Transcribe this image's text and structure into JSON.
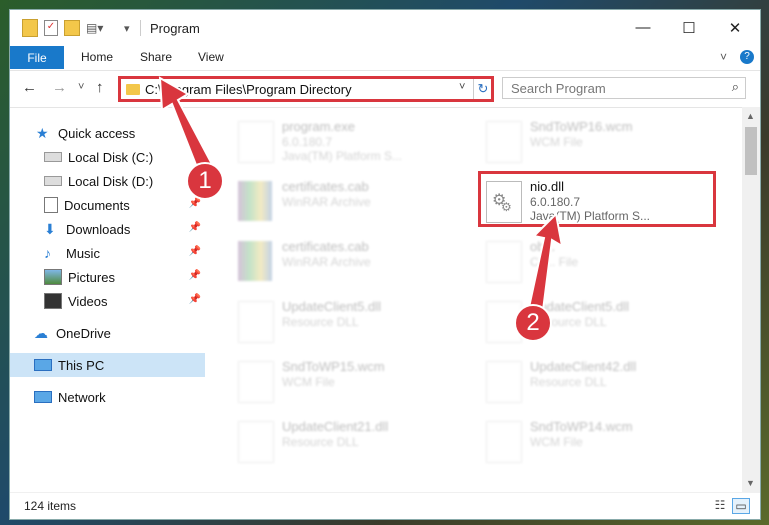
{
  "titlebar": {
    "title": "Program",
    "minimize_glyph": "—",
    "maximize_glyph": "☐",
    "close_glyph": "✕"
  },
  "ribbon": {
    "file": "File",
    "tabs": [
      "Home",
      "Share",
      "View"
    ],
    "expand_glyph": "˅",
    "help_glyph": "?"
  },
  "nav": {
    "back_glyph": "←",
    "forward_glyph": "→",
    "recent_glyph": "˅",
    "up_glyph": "↑",
    "address": "C:\\Program Files\\Program Directory",
    "address_drop": "˅",
    "refresh_glyph": "↻",
    "search_placeholder": "Search Program",
    "search_glyph": "⌕"
  },
  "sidebar": {
    "items": [
      {
        "label": "Quick access",
        "icon": "star-icon"
      },
      {
        "label": "Local Disk (C:)",
        "icon": "drive-icon"
      },
      {
        "label": "Local Disk (D:)",
        "icon": "drive-icon"
      },
      {
        "label": "Documents",
        "icon": "documents-icon"
      },
      {
        "label": "Downloads",
        "icon": "download-icon"
      },
      {
        "label": "Music",
        "icon": "music-icon"
      },
      {
        "label": "Pictures",
        "icon": "pictures-icon"
      },
      {
        "label": "Videos",
        "icon": "videos-icon"
      },
      {
        "label": "OneDrive",
        "icon": "cloud-icon"
      },
      {
        "label": "This PC",
        "icon": "computer-icon"
      },
      {
        "label": "Network",
        "icon": "network-icon"
      }
    ],
    "pin_glyph": "📌"
  },
  "files": [
    {
      "name": "program.exe",
      "line2": "6.0.180.7",
      "line3": "Java(TM) Platform S...",
      "type": "exe"
    },
    {
      "name": "SndToWP16.wcm",
      "line2": "WCM File",
      "line3": "",
      "type": "doc"
    },
    {
      "name": "certificates.cab",
      "line2": "WinRAR Archive",
      "line3": "",
      "type": "cab"
    },
    {
      "name": "nio.dll",
      "line2": "6.0.180.7",
      "line3": "Java(TM) Platform S...",
      "type": "dll"
    },
    {
      "name": "certificates.cab",
      "line2": "WinRAR Archive",
      "line3": "",
      "type": "cab"
    },
    {
      "name": "ob...",
      "line2": "Ca... File",
      "line3": "",
      "type": "doc"
    },
    {
      "name": "UpdateClient5.dll",
      "line2": "Resource DLL",
      "line3": "",
      "type": "dll"
    },
    {
      "name": "UpdateClient5.dll",
      "line2": "Resource DLL",
      "line3": "",
      "type": "dll"
    },
    {
      "name": "SndToWP15.wcm",
      "line2": "WCM File",
      "line3": "",
      "type": "doc"
    },
    {
      "name": "UpdateClient42.dll",
      "line2": "Resource DLL",
      "line3": "",
      "type": "dll"
    },
    {
      "name": "UpdateClient21.dll",
      "line2": "Resource DLL",
      "line3": "",
      "type": "dll"
    },
    {
      "name": "SndToWP14.wcm",
      "line2": "WCM File",
      "line3": "",
      "type": "doc"
    }
  ],
  "annotations": {
    "one": "1",
    "two": "2"
  },
  "status": {
    "count": "124 items"
  },
  "colors": {
    "accent": "#1979ca",
    "highlight": "#d9363e",
    "selection": "#cce4f7"
  }
}
